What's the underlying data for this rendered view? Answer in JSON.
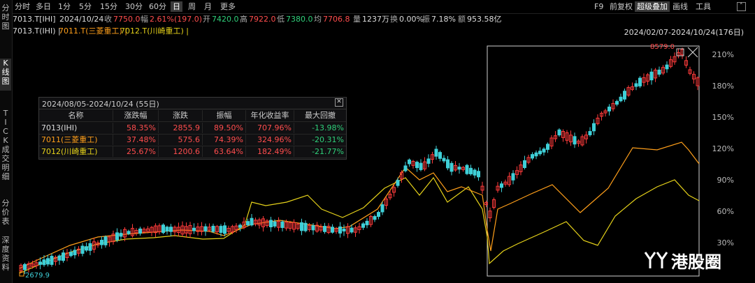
{
  "side_tabs": [
    "分时图",
    "K线图",
    "TICK",
    "成交明细",
    "分价表",
    "深度资料"
  ],
  "toolbar": {
    "periods": [
      "分时",
      "多日",
      "1分",
      "5分",
      "15分",
      "30分",
      "60分",
      "日",
      "周",
      "月",
      "更多"
    ],
    "active_period": "日",
    "right": [
      "F9",
      "前复权",
      "超级叠加",
      "画线",
      "工具"
    ],
    "active_right": "超级叠加"
  },
  "quote": {
    "symbol": "7013.T[IHI]",
    "date": "2024/10/24",
    "close_label": "收",
    "close": "7750.0",
    "change_label": "幅",
    "change": "2.61%(197.0)",
    "open_label": "开",
    "open": "7420.0",
    "high_label": "高",
    "high": "7922.0",
    "low_label": "低",
    "low": "7380.0",
    "avg_label": "均",
    "avg": "7706.8",
    "vol_label": "量",
    "vol": "1237万",
    "turn_label": "换",
    "turn": "0.00%",
    "amp_label": "振",
    "amp": "7.18%",
    "amt_label": "额",
    "amt": "953.58亿"
  },
  "legend": {
    "items": [
      {
        "text": "7013.T(IHI) |",
        "color": "#dddddd"
      },
      {
        "text": "7011.T(三菱重工) |",
        "color": "#ff9f1a"
      },
      {
        "text": "7012.T(川崎重工) |",
        "color": "#e6d21a"
      }
    ],
    "range": "2024/02/07-2024/10/24(176日)"
  },
  "stats": {
    "title": "2024/08/05-2024/10/24 (55日)",
    "headers": [
      "名称",
      "涨跌幅",
      "涨跌",
      "振幅",
      "年化收益率",
      "最大回撤"
    ],
    "rows": [
      {
        "name": "7013(IHI)",
        "name_color": "#dddddd",
        "chg_pct": "58.35%",
        "chg": "2855.9",
        "amp": "89.50%",
        "annual": "707.96%",
        "dd": "-13.98%"
      },
      {
        "name": "7011(三菱重工)",
        "name_color": "#ff9f1a",
        "chg_pct": "37.48%",
        "chg": "575.6",
        "amp": "74.39%",
        "annual": "324.96%",
        "dd": "-20.31%"
      },
      {
        "name": "7012(川崎重工)",
        "name_color": "#e6d21a",
        "chg_pct": "25.67%",
        "chg": "1200.6",
        "amp": "63.64%",
        "annual": "182.49%",
        "dd": "-21.77%"
      }
    ]
  },
  "chart": {
    "y_ticks": [
      "210%",
      "180%",
      "150%",
      "120%",
      "90%",
      "60%",
      "30%"
    ],
    "high_label": "8579.0",
    "low_label": "2679.9",
    "colors": {
      "up": "#ff3b3b",
      "down": "#3fd0d8",
      "line1": "#ff9f1a",
      "line2": "#e6d21a"
    }
  },
  "watermark": "港股圈"
}
